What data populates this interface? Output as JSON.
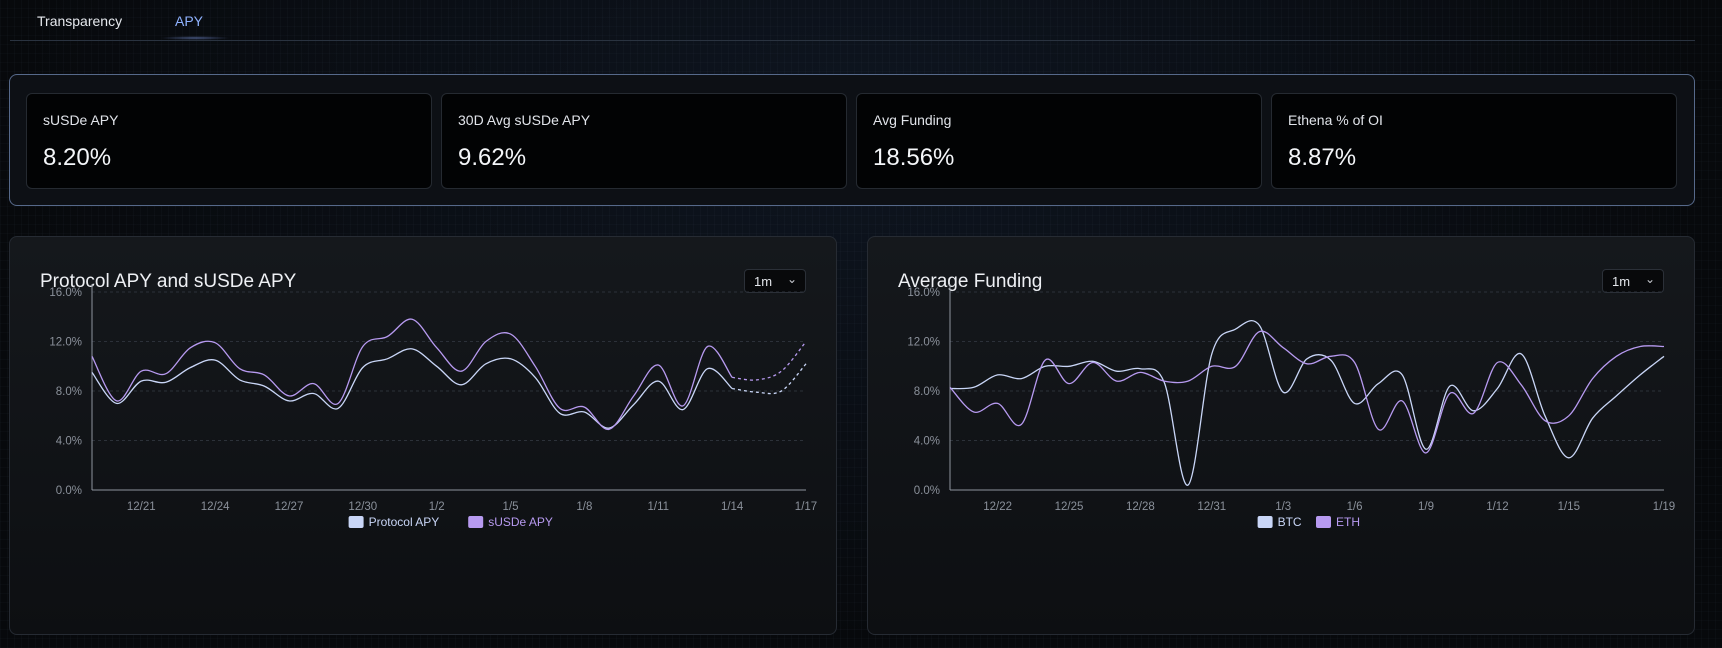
{
  "tabs": [
    {
      "label": "Transparency",
      "active": false
    },
    {
      "label": "APY",
      "active": true
    }
  ],
  "stats": [
    {
      "label": "sUSDe APY",
      "value": "8.20%"
    },
    {
      "label": "30D Avg sUSDe APY",
      "value": "9.62%"
    },
    {
      "label": "Avg Funding",
      "value": "18.56%"
    },
    {
      "label": "Ethena % of OI",
      "value": "8.87%"
    }
  ],
  "colors": {
    "accent_tab": "#8fb2ff",
    "series_blue": "#c9d6f7",
    "series_purple": "#b79af0"
  },
  "panels": {
    "protocol": {
      "title": "Protocol APY and sUSDe APY",
      "range": "1m",
      "chevron": "⌄"
    },
    "funding": {
      "title": "Average Funding",
      "range": "1m",
      "chevron": "⌄"
    }
  },
  "chart_data": [
    {
      "type": "line",
      "title": "Protocol APY and sUSDe APY",
      "x": [
        "12/19",
        "12/20",
        "12/21",
        "12/22",
        "12/23",
        "12/24",
        "12/25",
        "12/26",
        "12/27",
        "12/28",
        "12/29",
        "12/30",
        "12/31",
        "1/1",
        "1/2",
        "1/3",
        "1/4",
        "1/5",
        "1/6",
        "1/7",
        "1/8",
        "1/9",
        "1/10",
        "1/11",
        "1/12",
        "1/13",
        "1/14",
        "1/15",
        "1/16",
        "1/17"
      ],
      "xticks": [
        "12/21",
        "12/24",
        "12/27",
        "12/30",
        "1/2",
        "1/5",
        "1/8",
        "1/11",
        "1/14",
        "1/17"
      ],
      "yticks": [
        "0.0%",
        "4.0%",
        "8.0%",
        "12.0%",
        "16.0%"
      ],
      "ylim": [
        0,
        16
      ],
      "grid": true,
      "legend_position": "bottom",
      "series": [
        {
          "name": "Protocol APY",
          "color": "#c9d6f7",
          "values": [
            9.5,
            7.0,
            8.8,
            8.7,
            9.9,
            10.5,
            8.9,
            8.4,
            7.2,
            7.8,
            6.6,
            9.9,
            10.6,
            11.4,
            10.0,
            8.5,
            10.2,
            10.6,
            9.1,
            6.2,
            6.3,
            5.0,
            6.9,
            8.8,
            6.5,
            9.8,
            8.2,
            7.9,
            8.0,
            10.2
          ],
          "dashed_from_index": 26
        },
        {
          "name": "sUSDe APY",
          "color": "#b79af0",
          "values": [
            10.8,
            7.2,
            9.6,
            9.4,
            11.5,
            11.9,
            9.8,
            9.3,
            7.6,
            8.6,
            7.0,
            11.6,
            12.4,
            13.8,
            11.5,
            9.6,
            12.0,
            12.6,
            10.0,
            6.6,
            6.7,
            4.9,
            7.6,
            10.1,
            6.8,
            11.6,
            9.1,
            8.9,
            9.6,
            12.0
          ],
          "dashed_from_index": 26
        }
      ]
    },
    {
      "type": "line",
      "title": "Average Funding",
      "x": [
        "12/20",
        "12/21",
        "12/22",
        "12/23",
        "12/24",
        "12/25",
        "12/26",
        "12/27",
        "12/28",
        "12/29",
        "12/30",
        "12/31",
        "1/1",
        "1/2",
        "1/3",
        "1/4",
        "1/5",
        "1/6",
        "1/7",
        "1/8",
        "1/9",
        "1/10",
        "1/11",
        "1/12",
        "1/13",
        "1/14",
        "1/15",
        "1/16",
        "1/17",
        "1/18",
        "1/19"
      ],
      "xticks": [
        "12/22",
        "12/25",
        "12/28",
        "12/31",
        "1/3",
        "1/6",
        "1/9",
        "1/12",
        "1/15",
        "1/19"
      ],
      "yticks": [
        "0.0%",
        "4.0%",
        "8.0%",
        "12.0%",
        "16.0%"
      ],
      "ylim": [
        0,
        16
      ],
      "grid": true,
      "legend_position": "bottom",
      "series": [
        {
          "name": "BTC",
          "color": "#c9d6f7",
          "values": [
            8.2,
            8.3,
            9.3,
            9.0,
            10.0,
            10.0,
            10.4,
            9.6,
            9.8,
            8.7,
            0.4,
            11.0,
            13.0,
            13.3,
            7.9,
            10.6,
            10.5,
            7.0,
            8.6,
            9.3,
            3.3,
            8.4,
            6.4,
            8.2,
            11.0,
            6.0,
            2.6,
            5.8,
            7.6,
            9.3,
            10.8
          ]
        },
        {
          "name": "ETH",
          "color": "#b79af0",
          "values": [
            8.3,
            6.3,
            7.0,
            5.3,
            10.5,
            8.6,
            10.3,
            8.8,
            9.5,
            8.8,
            8.8,
            10.0,
            10.0,
            12.8,
            11.5,
            10.2,
            10.8,
            10.3,
            4.9,
            7.2,
            3.0,
            7.8,
            6.2,
            10.3,
            8.5,
            5.6,
            6.0,
            9.0,
            10.8,
            11.6,
            11.6
          ]
        }
      ]
    }
  ]
}
